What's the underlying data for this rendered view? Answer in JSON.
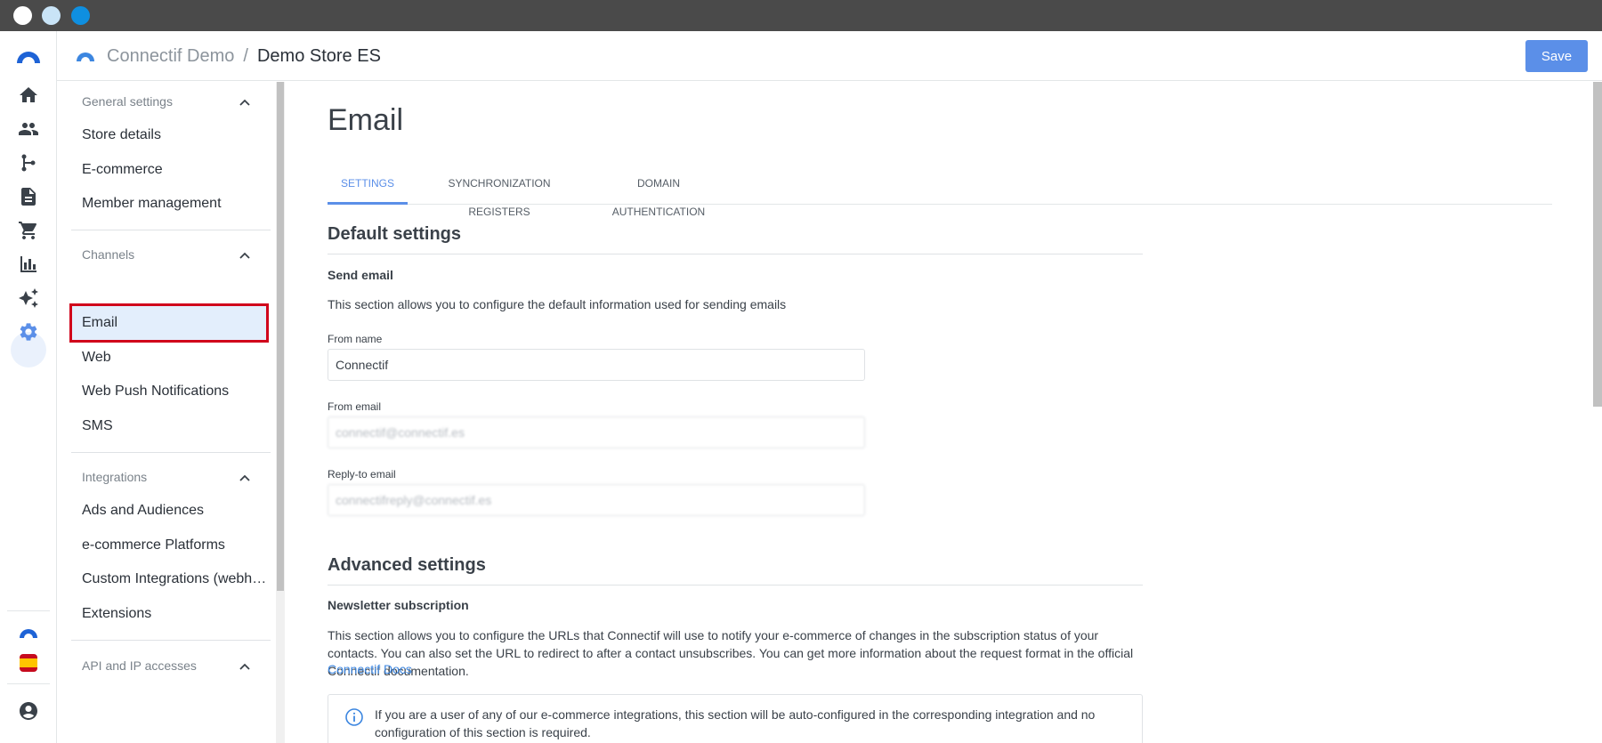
{
  "window": {
    "controls": [
      "close",
      "minimize",
      "maximize"
    ]
  },
  "header": {
    "org_name": "Connectif Demo",
    "separator": "/",
    "store_name": "Demo Store ES",
    "save_label": "Save"
  },
  "rail": {
    "items": [
      "home-icon",
      "contacts-icon",
      "workflows-icon",
      "content-icon",
      "cart-icon",
      "reports-icon",
      "ai-sparkle-icon",
      "settings-icon"
    ],
    "active": "settings-icon",
    "bottom": [
      "connectif-account-icon",
      "spain-flag-icon",
      "user-account-icon"
    ]
  },
  "sidebar": {
    "sections": [
      {
        "title": "General settings",
        "items": [
          "Store details",
          "E-commerce",
          "Member management"
        ]
      },
      {
        "title": "Channels",
        "items": [
          "Email",
          "Web",
          "Web Push Notifications",
          "SMS"
        ]
      },
      {
        "title": "Integrations",
        "items": [
          "Ads and Audiences",
          "e-commerce Platforms",
          "Custom Integrations (webh…",
          "Extensions"
        ]
      },
      {
        "title": "API and IP accesses",
        "items": []
      }
    ],
    "selected": "Email"
  },
  "main": {
    "title": "Email",
    "tabs": [
      "SETTINGS",
      "SYNCHRONIZATION REGISTERS",
      "DOMAIN AUTHENTICATION"
    ],
    "active_tab": "SETTINGS",
    "default_settings": {
      "heading": "Default settings",
      "send_email_heading": "Send email",
      "send_email_desc": "This section allows you to configure the default information used for sending emails",
      "from_name_label": "From name",
      "from_name_value": "Connectif",
      "from_email_label": "From email",
      "from_email_value": "connectif@connectif.es",
      "reply_to_label": "Reply-to email",
      "reply_to_value": "connectifreply@connectif.es"
    },
    "advanced_settings": {
      "heading": "Advanced settings",
      "newsletter_heading": "Newsletter subscription",
      "newsletter_desc": "This section allows you to configure the URLs that Connectif will use to notify your e-commerce of changes in the subscription status of your contacts. You can also set the URL to redirect to after a contact unsubscribes. You can get more information about the request format in the official Connectif documentation.",
      "docs_link": "Connectif Docs",
      "info_text": "If you are a user of any of our e-commerce integrations, this section will be auto-configured in the corresponding integration and no configuration of this section is required."
    }
  },
  "colors": {
    "accent": "#5b8fe8",
    "selection_bg": "#e3eefc",
    "highlight_border": "#d0021b",
    "link": "#3c86e0"
  }
}
